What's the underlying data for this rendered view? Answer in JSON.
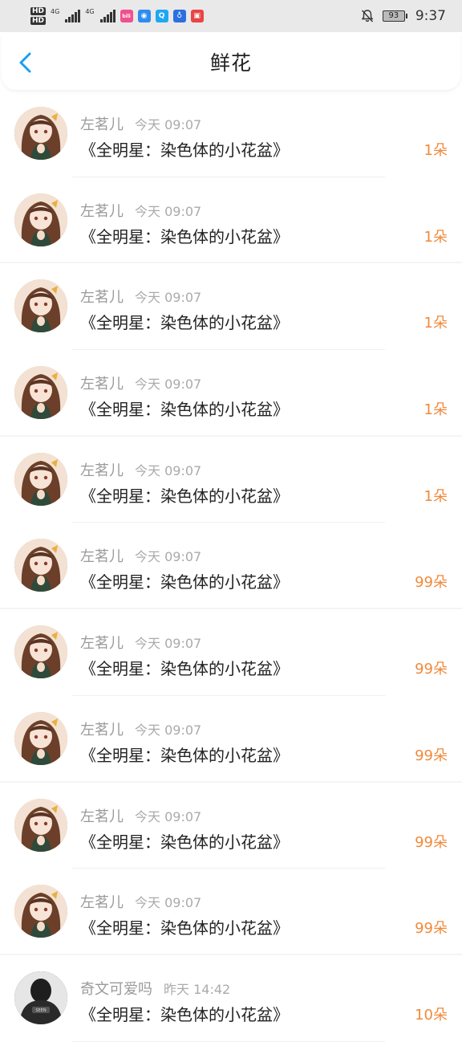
{
  "status_bar": {
    "hd1": "HD",
    "hd2": "HD",
    "net1": "4G",
    "net2": "4G",
    "battery": "93",
    "time": "9:37",
    "app_icons": [
      {
        "name": "bilibili-app-icon",
        "color": "#f0508c",
        "glyph": "bili"
      },
      {
        "name": "browser-app-icon",
        "color": "#2d8cf0",
        "glyph": "◉"
      },
      {
        "name": "search-app-icon",
        "color": "#1ea7f2",
        "glyph": "Q"
      },
      {
        "name": "lightbulb-app-icon",
        "color": "#2b6fe0",
        "glyph": "♁"
      },
      {
        "name": "book-app-icon",
        "color": "#e84545",
        "glyph": "▣"
      }
    ]
  },
  "header": {
    "title": "鲜花",
    "back_icon": "chevron-left-icon",
    "accent": "#1a9ff2"
  },
  "colors": {
    "count": "#f08a3c"
  },
  "items": [
    {
      "name": "左茗儿",
      "time": "今天 09:07",
      "gift": "《全明星：染色体的小花盆》",
      "count": "1朵",
      "avatar": "anime-girl"
    },
    {
      "name": "左茗儿",
      "time": "今天 09:07",
      "gift": "《全明星：染色体的小花盆》",
      "count": "1朵",
      "avatar": "anime-girl"
    },
    {
      "name": "左茗儿",
      "time": "今天 09:07",
      "gift": "《全明星：染色体的小花盆》",
      "count": "1朵",
      "avatar": "anime-girl"
    },
    {
      "name": "左茗儿",
      "time": "今天 09:07",
      "gift": "《全明星：染色体的小花盆》",
      "count": "1朵",
      "avatar": "anime-girl"
    },
    {
      "name": "左茗儿",
      "time": "今天 09:07",
      "gift": "《全明星：染色体的小花盆》",
      "count": "1朵",
      "avatar": "anime-girl"
    },
    {
      "name": "左茗儿",
      "time": "今天 09:07",
      "gift": "《全明星：染色体的小花盆》",
      "count": "99朵",
      "avatar": "anime-girl"
    },
    {
      "name": "左茗儿",
      "time": "今天 09:07",
      "gift": "《全明星：染色体的小花盆》",
      "count": "99朵",
      "avatar": "anime-girl"
    },
    {
      "name": "左茗儿",
      "time": "今天 09:07",
      "gift": "《全明星：染色体的小花盆》",
      "count": "99朵",
      "avatar": "anime-girl"
    },
    {
      "name": "左茗儿",
      "time": "今天 09:07",
      "gift": "《全明星：染色体的小花盆》",
      "count": "99朵",
      "avatar": "anime-girl"
    },
    {
      "name": "左茗儿",
      "time": "今天 09:07",
      "gift": "《全明星：染色体的小花盆》",
      "count": "99朵",
      "avatar": "anime-girl"
    },
    {
      "name": "奇文可爱吗",
      "time": "昨天 14:42",
      "gift": "《全明星：染色体的小花盆》",
      "count": "10朵",
      "avatar": "dark-hoodie"
    }
  ]
}
